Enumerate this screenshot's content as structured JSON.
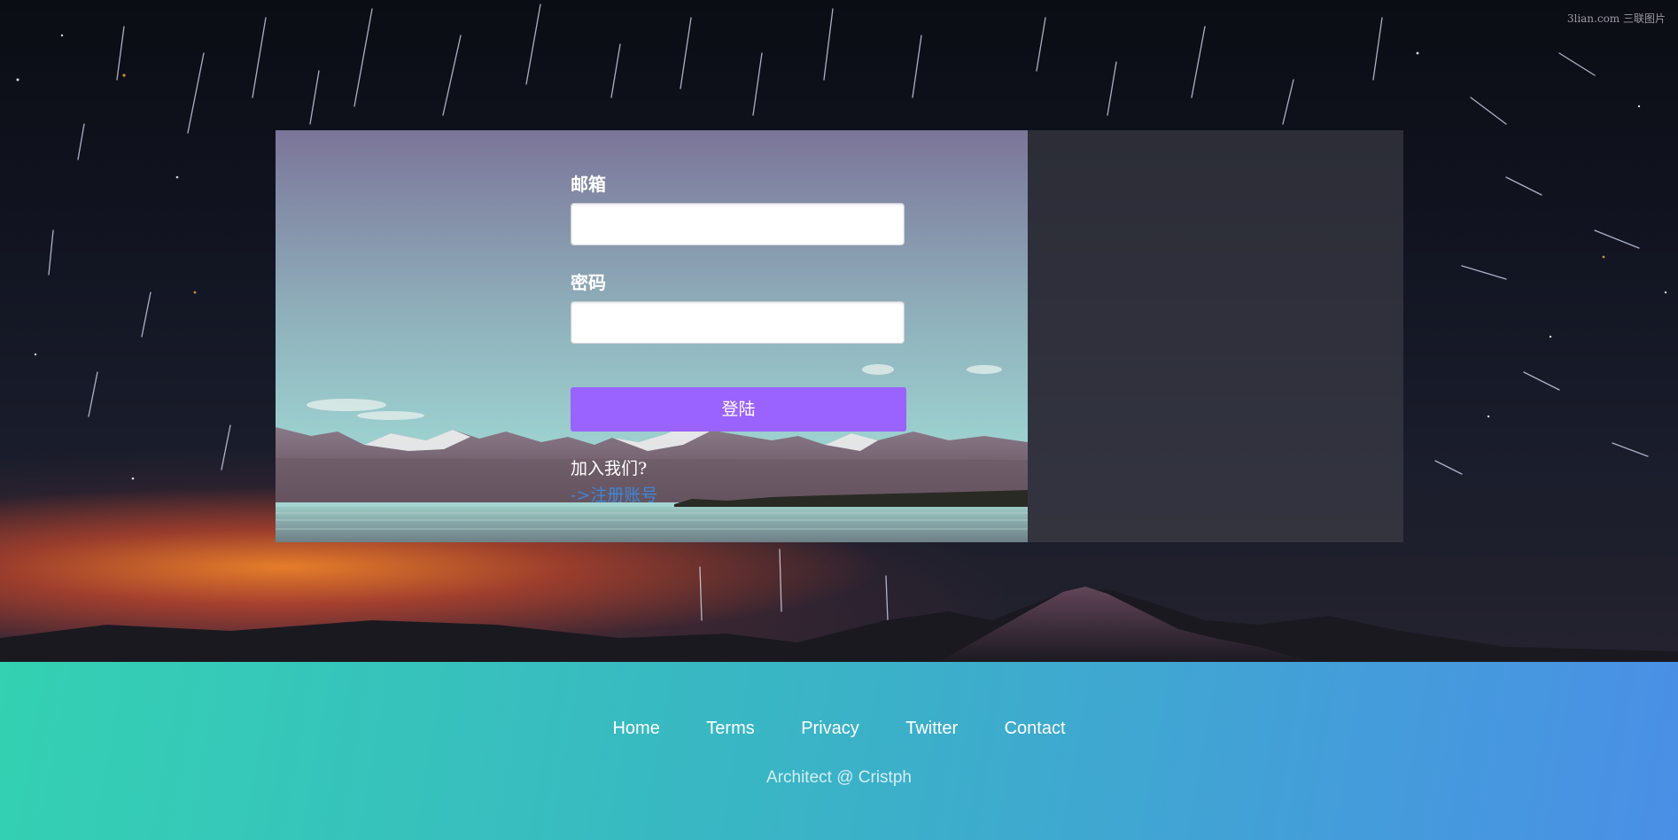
{
  "watermark": "3lian.com 三联图片",
  "login": {
    "email_label": "邮箱",
    "email_value": "",
    "password_label": "密码",
    "password_value": "",
    "submit_label": "登陆",
    "join_text": "加入我们?",
    "register_link": "->注册账号"
  },
  "footer": {
    "nav": [
      "Home",
      "Terms",
      "Privacy",
      "Twitter",
      "Contact"
    ],
    "credit": "Architect @ Cristph"
  },
  "colors": {
    "accent_button": "#9a63ff",
    "link": "#3f86d8",
    "footer_gradient_start": "#34d1b2",
    "footer_gradient_end": "#4a8fe6"
  }
}
